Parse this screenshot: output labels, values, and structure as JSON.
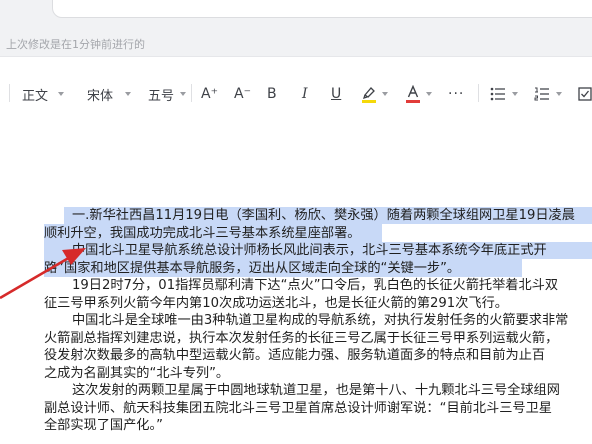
{
  "header": {
    "saved_status": "上次修改是在1分钟前进行的"
  },
  "toolbar": {
    "paragraph_style": "正文",
    "font_family": "宋体",
    "font_size": "五号",
    "increase_font": "A⁺",
    "decrease_font": "A⁻",
    "bold": "B",
    "italic": "I",
    "underline": "U",
    "highlight_color": "#f5d90a",
    "font_color": "#e23c39",
    "more": "···"
  },
  "document": {
    "lines": [
      "一.新华社西昌11月19日电（李国利、杨欣、樊永强）随着两颗全球组网卫星19日凌晨",
      "顺利升空，我国成功完成北斗三号基本系统星座部署。",
      "中国北斗卫星导航系统总设计师杨长风此间表示，北斗三号基本系统今年底正式开",
      "路”国家和地区提供基本导航服务，迈出从区域走向全球的“关键一步”。",
      "19日2时7分，01指挥员鄢利清下达“点火”口令后，乳白色的长征火箭托举着北斗双",
      "征三号甲系列火箭今年内第10次成功运送北斗，也是长征火箭的第291次飞行。",
      "中国北斗是全球唯一由3种轨道卫星构成的导航系统，对执行发射任务的火箭要求非常",
      "火箭副总指挥刘建忠说，执行本次发射任务的长征三号乙属于长征三号甲系列运载火箭，",
      "役发射次数最多的高轨中型运载火箭。适应能力强、服务轨道面多的特点和目前为止百",
      "之成为名副其实的“北斗专列”。",
      "这次发射的两颗卫星属于中圆地球轨道卫星，也是第十八、十九颗北斗三号全球组网",
      "副总设计师、航天科技集团五院北斗三号卫星首席总设计师谢军说：“目前北斗三号卫星",
      "全部实现了国产化。”"
    ]
  }
}
